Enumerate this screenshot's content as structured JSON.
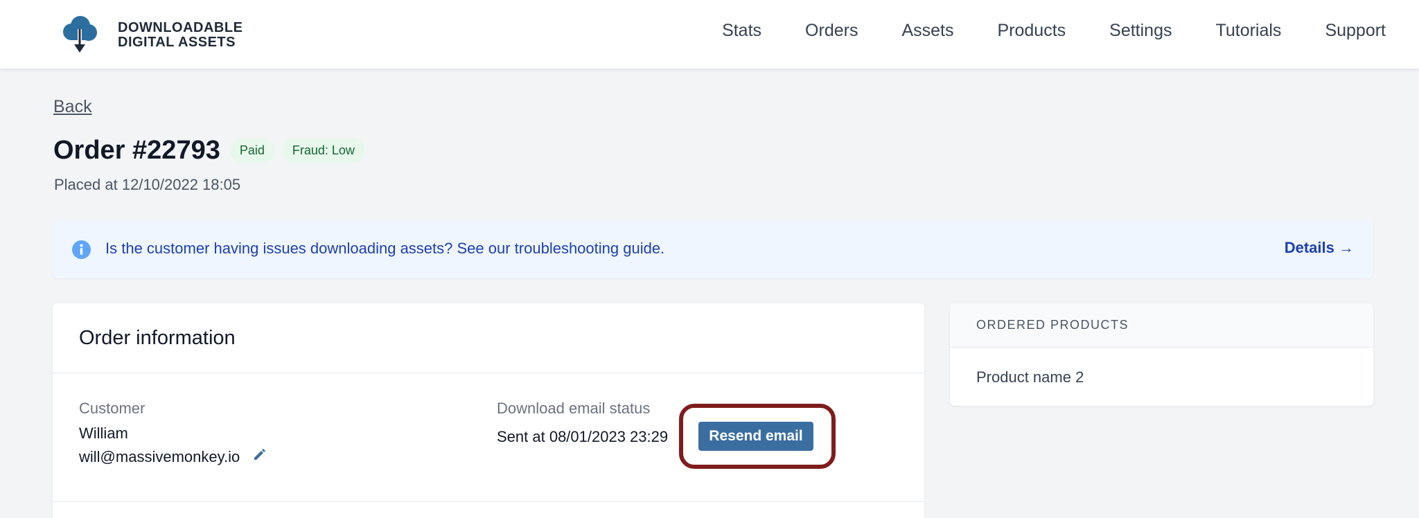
{
  "brand": {
    "name_line1": "DOWNLOADABLE",
    "name_line2": "DIGITAL ASSETS",
    "logo_icon": "cloud-download-icon",
    "color": "#2c6e9e"
  },
  "nav": {
    "items": [
      {
        "label": "Stats"
      },
      {
        "label": "Orders"
      },
      {
        "label": "Assets"
      },
      {
        "label": "Products"
      },
      {
        "label": "Settings"
      },
      {
        "label": "Tutorials"
      },
      {
        "label": "Support"
      }
    ]
  },
  "header": {
    "back_label": "Back",
    "order_title": "Order #22793",
    "badges": [
      {
        "label": "Paid",
        "color": "#166534"
      },
      {
        "label": "Fraud: Low",
        "color": "#166534"
      }
    ],
    "placed": "Placed at 12/10/2022 18:05"
  },
  "alert": {
    "icon": "info-icon",
    "text": "Is the customer having issues downloading assets? See our troubleshooting guide.",
    "link_label": "Details →",
    "color": "#1e40af"
  },
  "order_info": {
    "title": "Order information",
    "customer_label": "Customer",
    "customer_name": "William",
    "customer_email": "will@massivemonkey.io",
    "edit_icon": "pencil-icon",
    "email_status_label": "Download email status",
    "email_status_value": "Sent at 08/01/2023 23:29",
    "resend_label": "Resend email",
    "highlight_color": "#7f1d1d"
  },
  "ordered_products": {
    "title": "ORDERED PRODUCTS",
    "items": [
      {
        "name": "Product name 2"
      }
    ]
  }
}
